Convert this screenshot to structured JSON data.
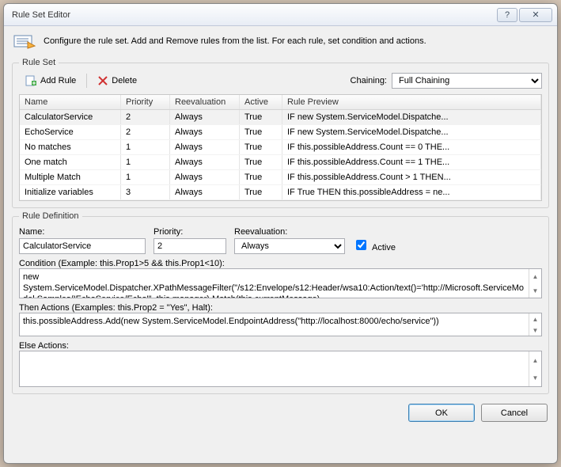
{
  "window": {
    "title": "Rule Set Editor"
  },
  "instruction": "Configure the rule set. Add and Remove rules from the list. For each rule, set condition and actions.",
  "ruleset": {
    "legend": "Rule Set",
    "toolbar": {
      "add_label": "Add Rule",
      "delete_label": "Delete",
      "chaining_label": "Chaining:",
      "chaining_value": "Full Chaining"
    },
    "columns": {
      "name": "Name",
      "priority": "Priority",
      "reeval": "Reevaluation",
      "active": "Active",
      "preview": "Rule Preview"
    },
    "rows": [
      {
        "name": "CalculatorService",
        "priority": "2",
        "reeval": "Always",
        "active": "True",
        "preview": "IF new System.ServiceModel.Dispatche..."
      },
      {
        "name": "EchoService",
        "priority": "2",
        "reeval": "Always",
        "active": "True",
        "preview": "IF new System.ServiceModel.Dispatche..."
      },
      {
        "name": "No matches",
        "priority": "1",
        "reeval": "Always",
        "active": "True",
        "preview": "IF this.possibleAddress.Count == 0 THE..."
      },
      {
        "name": "One match",
        "priority": "1",
        "reeval": "Always",
        "active": "True",
        "preview": "IF this.possibleAddress.Count == 1 THE..."
      },
      {
        "name": "Multiple Match",
        "priority": "1",
        "reeval": "Always",
        "active": "True",
        "preview": "IF this.possibleAddress.Count > 1 THEN..."
      },
      {
        "name": "Initialize variables",
        "priority": "3",
        "reeval": "Always",
        "active": "True",
        "preview": "IF True THEN this.possibleAddress = ne..."
      }
    ]
  },
  "ruledef": {
    "legend": "Rule Definition",
    "name_label": "Name:",
    "name_value": "CalculatorService",
    "priority_label": "Priority:",
    "priority_value": "2",
    "reeval_label": "Reevaluation:",
    "reeval_value": "Always",
    "active_label": "Active",
    "condition_label": "Condition (Example: this.Prop1>5 && this.Prop1<10):",
    "condition_value": "new System.ServiceModel.Dispatcher.XPathMessageFilter(\"/s12:Envelope/s12:Header/wsa10:Action/text()='http://Microsoft.ServiceModel.Samples/IEchoService/Echo'\", this.manager).Match(this.currentMessage)",
    "then_label": "Then Actions (Examples: this.Prop2 = \"Yes\", Halt):",
    "then_value": "this.possibleAddress.Add(new System.ServiceModel.EndpointAddress(\"http://localhost:8000/echo/service\"))",
    "else_label": "Else Actions:",
    "else_value": ""
  },
  "buttons": {
    "ok": "OK",
    "cancel": "Cancel"
  }
}
